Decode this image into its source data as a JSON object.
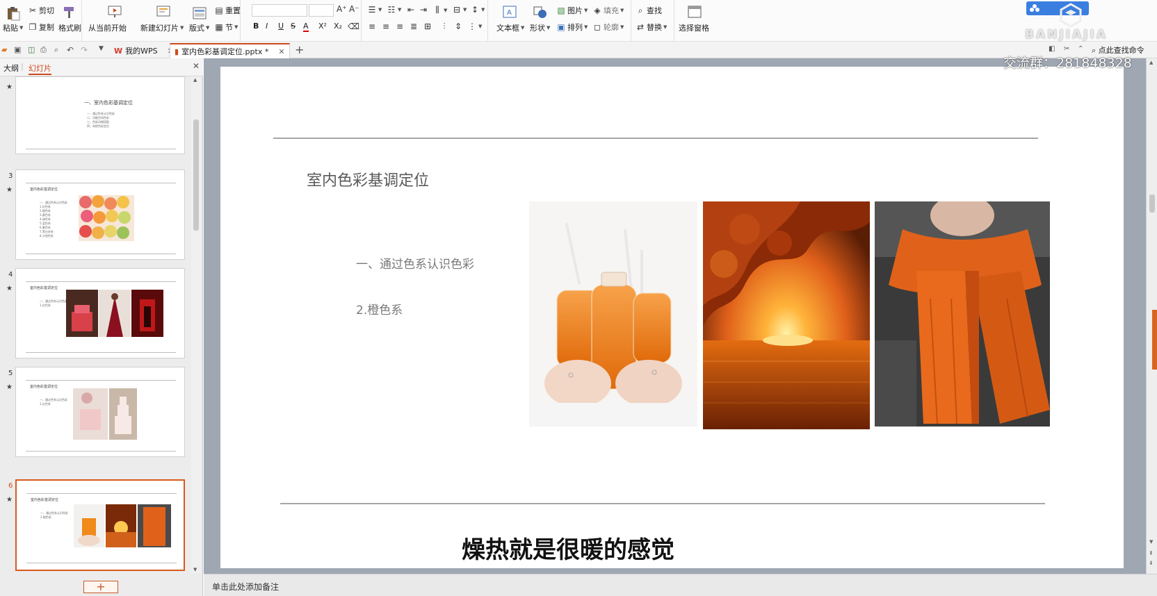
{
  "ribbon": {
    "paste": "粘贴",
    "cut": "剪切",
    "copy": "复制",
    "format_painter": "格式刷",
    "from_current": "从当前开始",
    "new_slide": "新建幻灯片",
    "layout": "版式",
    "section": "节",
    "reset": "重置",
    "textbox": "文本框",
    "shape": "形状",
    "picture": "图片",
    "fill": "填充",
    "arrange": "排列",
    "outline": "轮廓",
    "find": "查找",
    "replace": "替换",
    "selection_pane": "选择窗格",
    "bold": "B",
    "italic": "I",
    "underline": "U",
    "strike": "S",
    "font_color": "A",
    "superscript": "X²",
    "subscript": "X₂"
  },
  "tabs": {
    "wps": "我的WPS",
    "doc": "室内色彩基调定位.pptx *"
  },
  "left_panel": {
    "outline_tab": "大纲",
    "slides_tab": "幻灯片",
    "thumbs": [
      {
        "num": "",
        "title": "一、室内色彩基调定位",
        "lines": [
          "一、通过色系认识色彩",
          "二、功能空间色彩",
          "三、色彩风格搭配",
          "四、材质色彩定位"
        ]
      },
      {
        "num": "3",
        "title": "室内色彩基调定位",
        "lines": [
          "一、通过色系认识色彩",
          "1.红色系",
          "2.橙色系",
          "3.黄色系",
          "4.绿色系",
          "5.蓝色系",
          "6.紫色系",
          "7.黑白灰系",
          "8.大地色系"
        ]
      },
      {
        "num": "4",
        "title": "室内色彩基调定位",
        "lines": [
          "一、通过色系认识色彩",
          "1.红色系"
        ]
      },
      {
        "num": "5",
        "title": "室内色彩基调定位",
        "lines": [
          "一、通过色系认识色彩",
          "1.红色系"
        ]
      },
      {
        "num": "6",
        "title": "室内色彩基调定位",
        "lines": [
          "一、通过色系认识色彩",
          "2.橙色系"
        ]
      }
    ],
    "add": "+"
  },
  "slide": {
    "title": "室内色彩基调定位",
    "subtitle1": "一、通过色系认识色彩",
    "subtitle2": "2.橙色系",
    "caption": "燥热就是很暖的感觉"
  },
  "status": {
    "notes": "单击此处添加备注"
  },
  "watermark": {
    "brand": "BANJIAJIA",
    "group": "交流群：281848328",
    "search_cmd": "点此查找命令"
  },
  "colors": {
    "accent": "#d75a1c",
    "canvas_bg": "#9fa7b3"
  }
}
